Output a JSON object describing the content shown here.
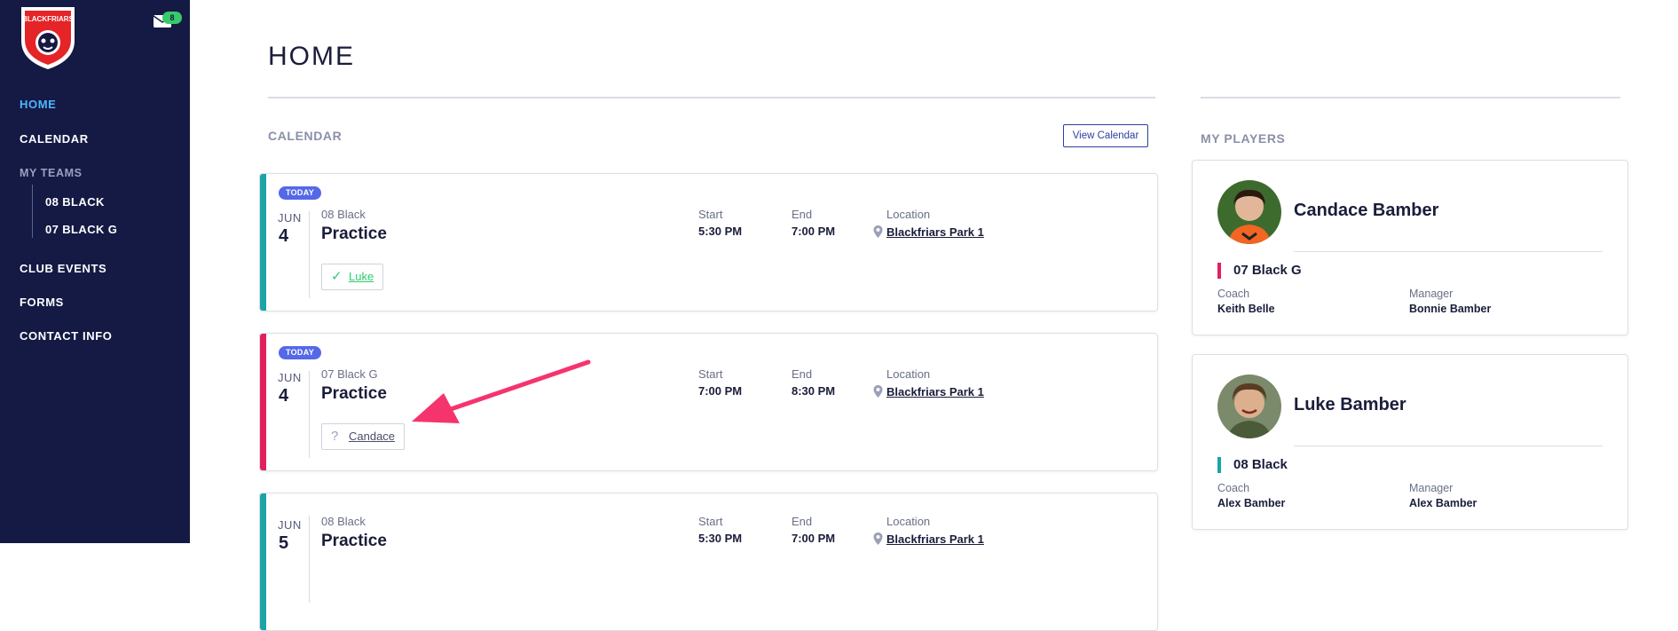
{
  "sidebar": {
    "logo_text": "BLACKFRIARS",
    "mail_count": "8",
    "nav": {
      "home": "HOME",
      "calendar": "CALENDAR",
      "my_teams": "MY TEAMS",
      "teams": [
        "08 BLACK",
        "07 BLACK G"
      ],
      "club_events": "CLUB EVENTS",
      "forms": "FORMS",
      "contact_info": "CONTACT INFO"
    },
    "colors": {
      "bg": "#141a44",
      "active": "#4fb4ff"
    }
  },
  "main": {
    "title": "HOME",
    "calendar_label": "CALENDAR",
    "view_calendar": "View Calendar",
    "events": [
      {
        "badge": "TODAY",
        "month": "JUN",
        "day": "4",
        "team": "08 Black",
        "title": "Practice",
        "start_label": "Start",
        "start": "5:30 PM",
        "end_label": "End",
        "end": "7:00 PM",
        "location_label": "Location",
        "location": "Blackfriars Park 1",
        "rsvp_icon": "check-icon",
        "rsvp_name": "Luke",
        "stripe_color": "#1ba3a8"
      },
      {
        "badge": "TODAY",
        "month": "JUN",
        "day": "4",
        "team": "07 Black G",
        "title": "Practice",
        "start_label": "Start",
        "start": "7:00 PM",
        "end_label": "End",
        "end": "8:30 PM",
        "location_label": "Location",
        "location": "Blackfriars Park 1",
        "rsvp_icon": "question-icon",
        "rsvp_name": "Candace",
        "stripe_color": "#e0215e"
      },
      {
        "month": "JUN",
        "day": "5",
        "team": "08 Black",
        "title": "Practice",
        "start_label": "Start",
        "start": "5:30 PM",
        "end_label": "End",
        "end": "7:00 PM",
        "location_label": "Location",
        "location": "Blackfriars Park 1",
        "stripe_color": "#1ba3a8"
      }
    ]
  },
  "players": {
    "label": "MY PLAYERS",
    "list": [
      {
        "name": "Candace Bamber",
        "team": "07 Black G",
        "team_color": "#e0215e",
        "coach_label": "Coach",
        "coach": "Keith Belle",
        "manager_label": "Manager",
        "manager": "Bonnie Bamber"
      },
      {
        "name": "Luke Bamber",
        "team": "08 Black",
        "team_color": "#1ba3a8",
        "coach_label": "Coach",
        "coach": "Alex Bamber",
        "manager_label": "Manager",
        "manager": "Alex Bamber"
      }
    ]
  }
}
